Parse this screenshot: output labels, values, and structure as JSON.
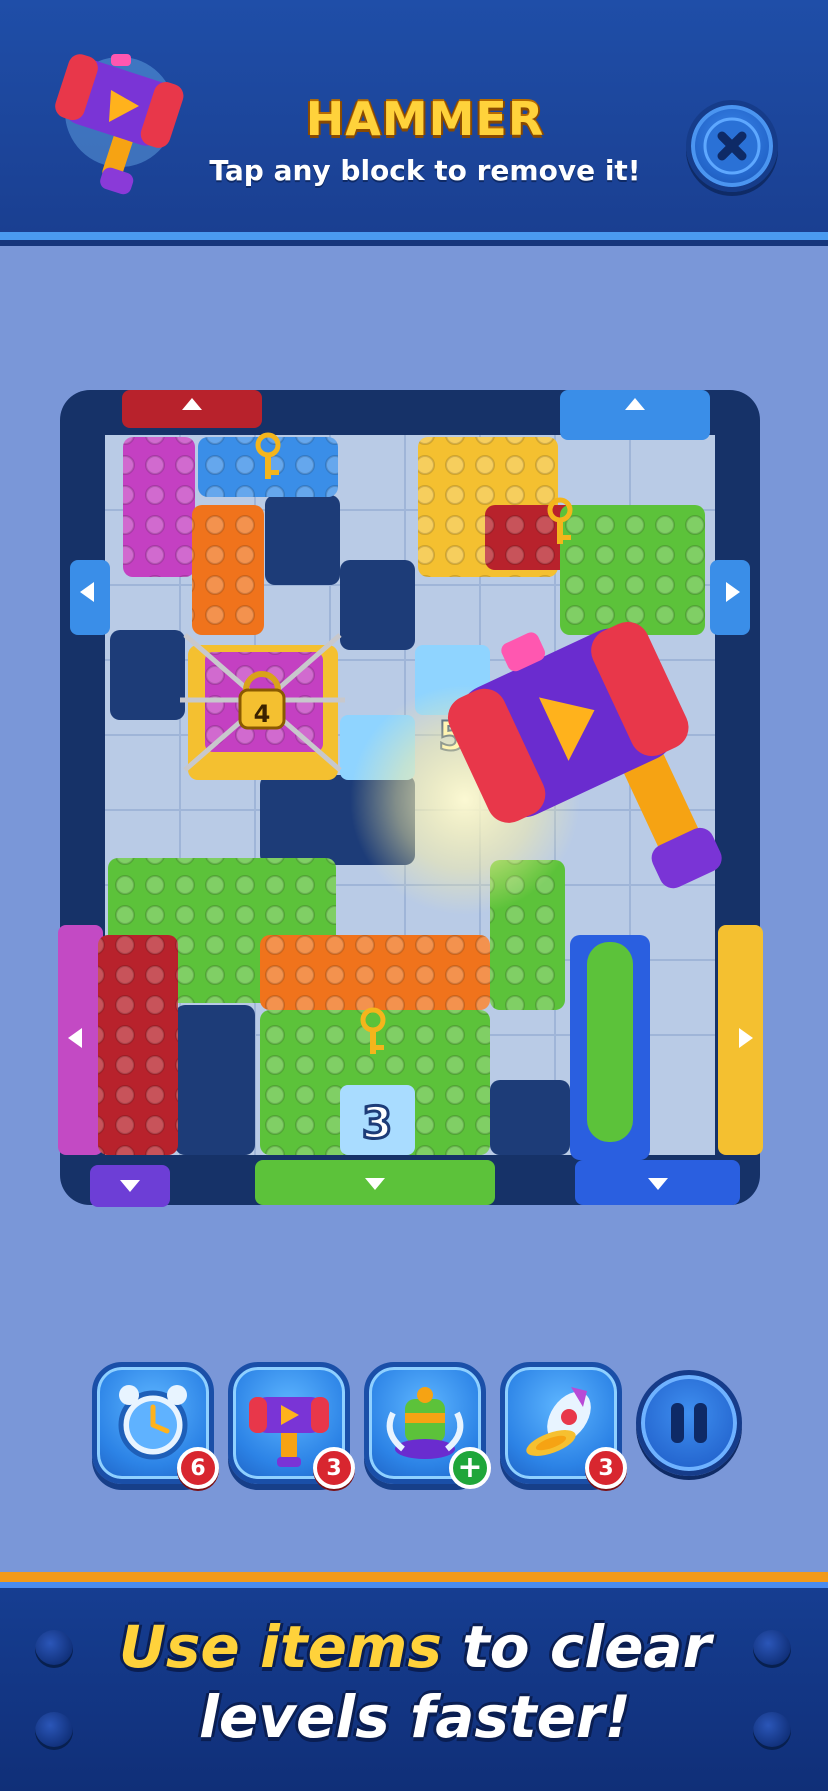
{
  "header": {
    "title": "HAMMER",
    "subtitle": "Tap any block to remove it!"
  },
  "board": {
    "timer_lock_count": "4",
    "ice_count_a": "5",
    "ice_count_b": "3"
  },
  "items": [
    {
      "name": "clock-freeze",
      "count": "6"
    },
    {
      "name": "hammer",
      "count": "3"
    },
    {
      "name": "vacuum",
      "count": "+"
    },
    {
      "name": "rocket",
      "count": "3"
    }
  ],
  "footer": {
    "line1_highlight": "Use items",
    "line1_rest": " to clear",
    "line2": "levels faster!"
  },
  "colors": {
    "header_bg": "#1f4ea8",
    "title_yellow": "#ffd23b",
    "board_bg": "#7a97d8",
    "footer_bg": "#163e92",
    "badge_red": "#d8262f",
    "badge_green": "#1fa63a"
  }
}
